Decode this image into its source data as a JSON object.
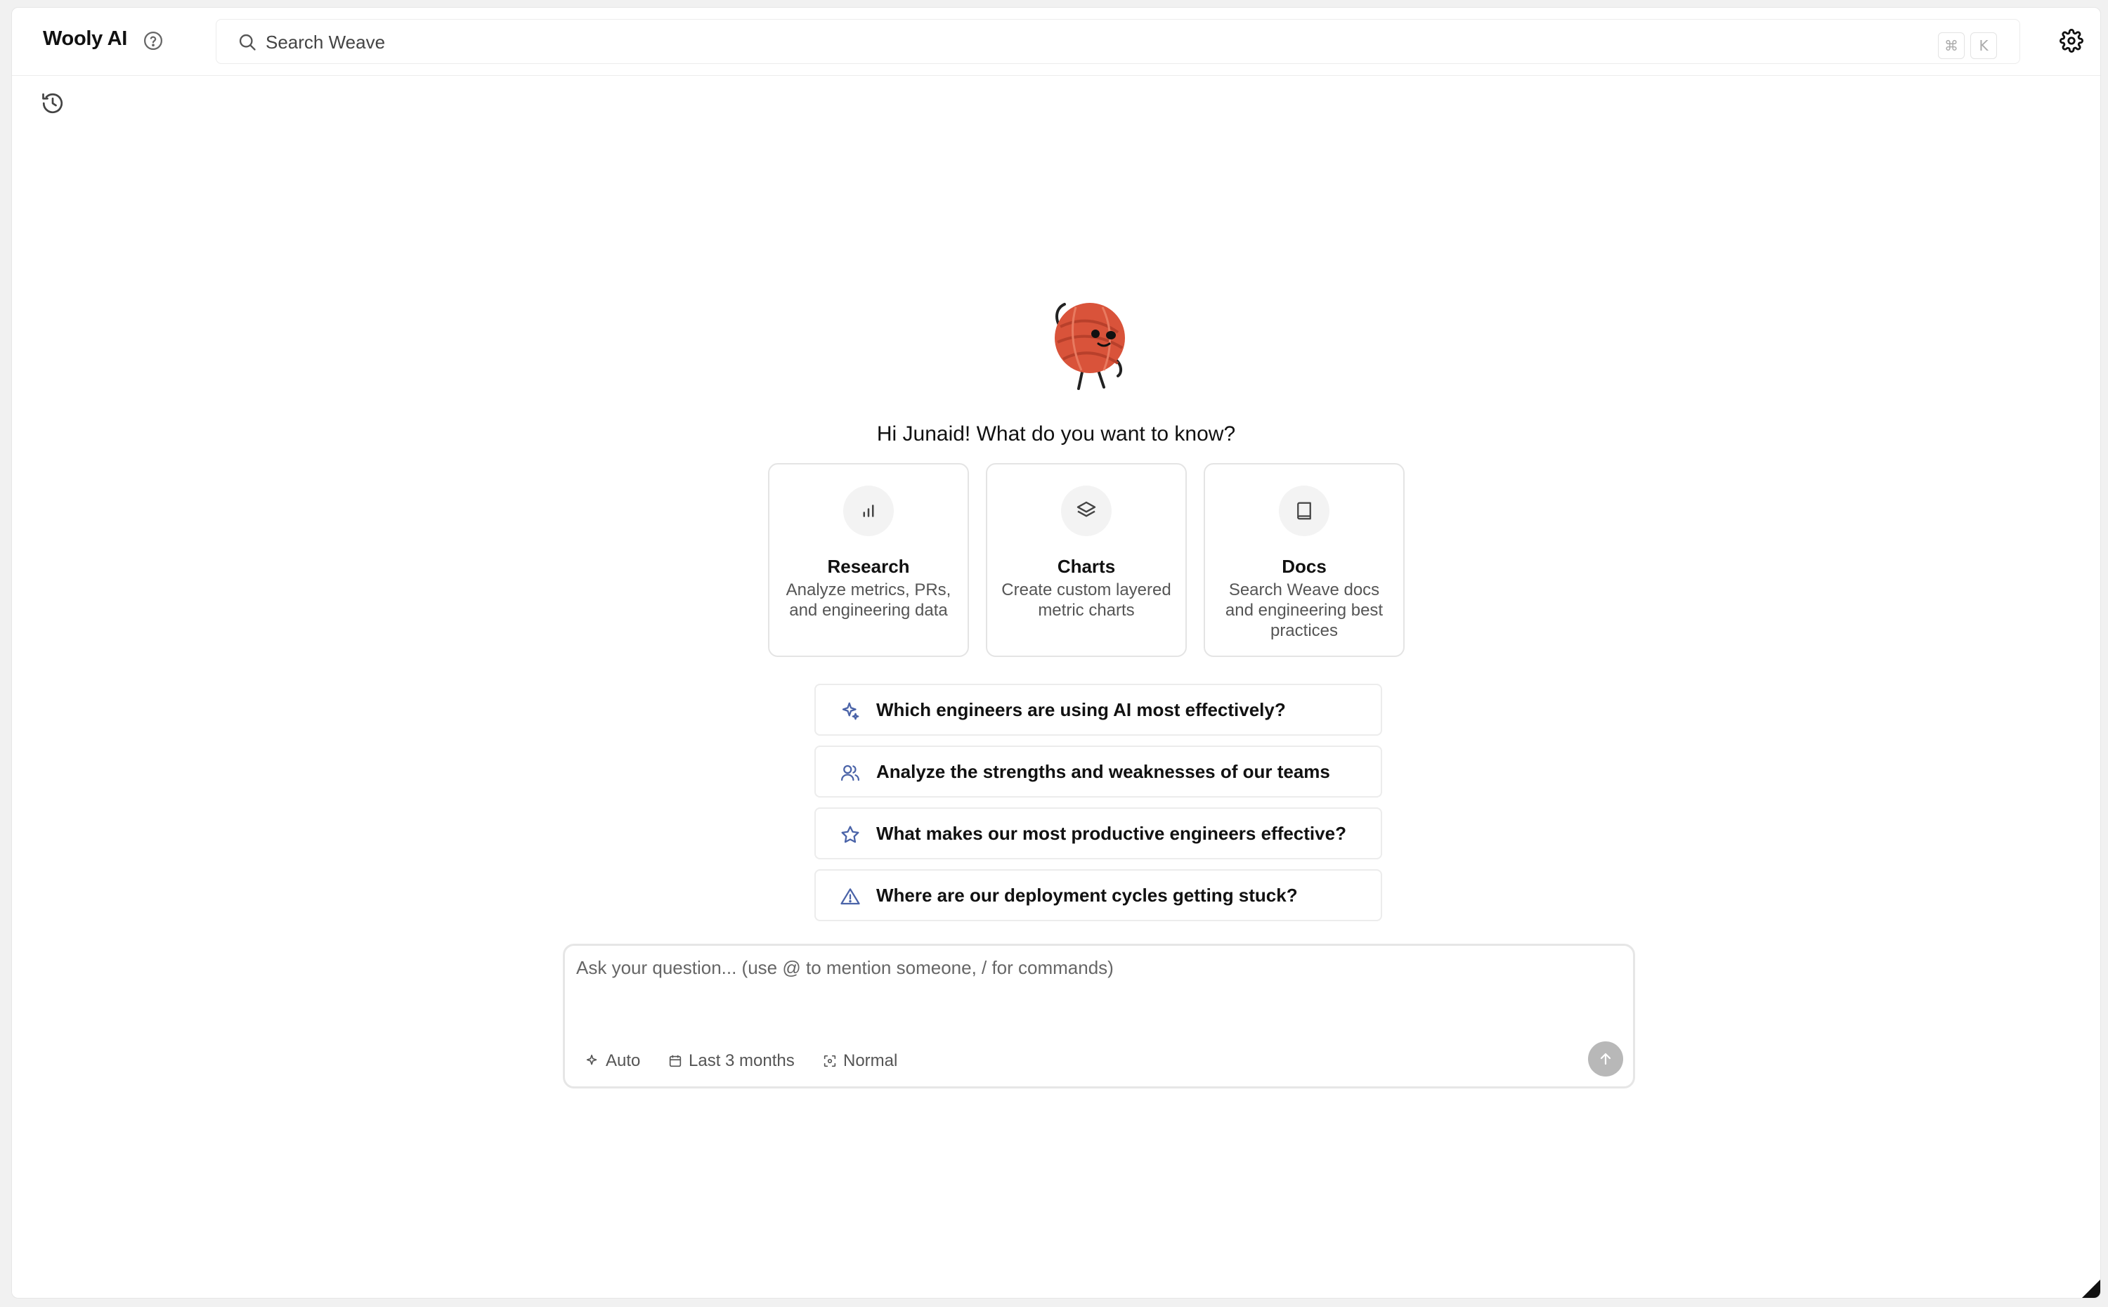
{
  "header": {
    "app_title": "Wooly AI",
    "search": {
      "placeholder": "Search Weave",
      "shortcut_cmd": "⌘",
      "shortcut_key": "K"
    }
  },
  "greeting": "Hi Junaid! What do you want to know?",
  "cards": [
    {
      "title": "Research",
      "description": "Analyze metrics, PRs, and engineering data",
      "icon": "bar-chart-icon"
    },
    {
      "title": "Charts",
      "description": "Create custom layered metric charts",
      "icon": "layers-icon"
    },
    {
      "title": "Docs",
      "description": "Search Weave docs and engineering best practices",
      "icon": "book-icon"
    }
  ],
  "suggestions": [
    {
      "text": "Which engineers are using AI most effectively?",
      "icon": "sparkles-icon"
    },
    {
      "text": "Analyze the strengths and weaknesses of our teams",
      "icon": "users-icon"
    },
    {
      "text": "What makes our most productive engineers effective?",
      "icon": "star-icon"
    },
    {
      "text": "Where are our deployment cycles getting stuck?",
      "icon": "warning-icon"
    }
  ],
  "composer": {
    "placeholder": "Ask your question... (use @ to mention someone, / for commands)",
    "options": {
      "model": "Auto",
      "date_range": "Last 3 months",
      "mode": "Normal"
    }
  },
  "colors": {
    "accent_icon": "#4a63a8",
    "send_disabled": "#b8b8b8",
    "mascot": "#d9533a"
  }
}
